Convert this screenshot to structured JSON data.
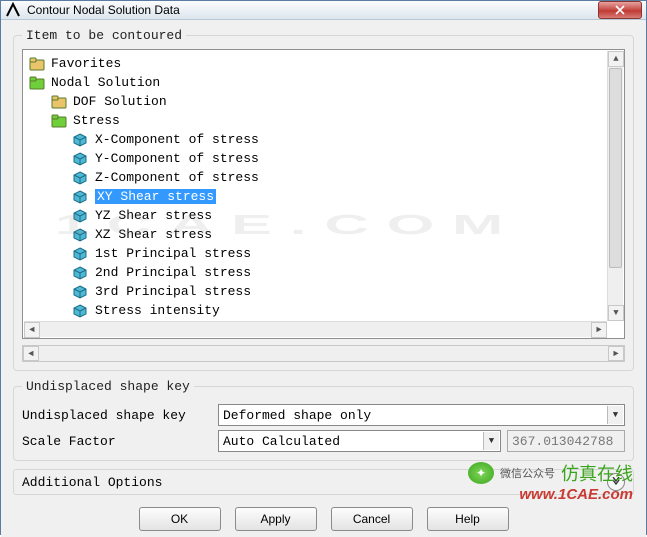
{
  "window": {
    "title": "Contour Nodal Solution Data"
  },
  "group1": {
    "legend": "Item to be contoured"
  },
  "tree": {
    "favorites": "Favorites",
    "nodal_solution": "Nodal Solution",
    "dof_solution": "DOF Solution",
    "stress": "Stress",
    "items": [
      "X-Component of stress",
      "Y-Component of stress",
      "Z-Component of stress",
      "XY Shear stress",
      "YZ Shear stress",
      "XZ Shear stress",
      "1st Principal stress",
      "2nd Principal stress",
      "3rd Principal stress",
      "Stress intensity"
    ],
    "selected_index": 3
  },
  "group2": {
    "legend": "Undisplaced shape key",
    "label1": "Undisplaced shape key",
    "value1": "Deformed shape only",
    "label2": "Scale Factor",
    "value2": "Auto Calculated",
    "numeric": "367.013042788"
  },
  "additional": {
    "label": "Additional Options"
  },
  "buttons": {
    "ok": "OK",
    "apply": "Apply",
    "cancel": "Cancel",
    "help": "Help"
  },
  "watermark": {
    "wx": "微信公众号",
    "cn": "仿真在线",
    "url": "www.1CAE.com"
  }
}
